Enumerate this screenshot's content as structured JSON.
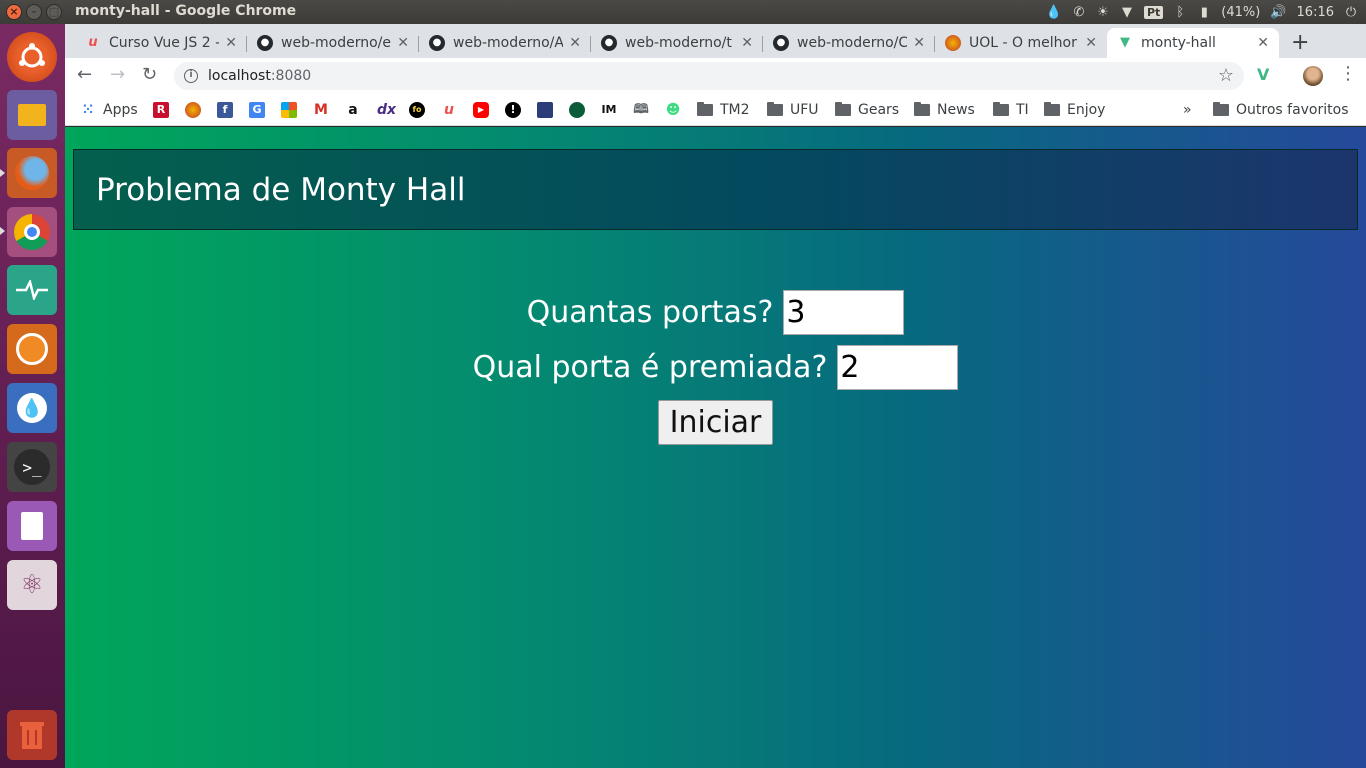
{
  "system": {
    "window_title": "monty-hall - Google Chrome",
    "battery": "(41%)",
    "clock": "16:16",
    "keyboard": "Pt"
  },
  "tabs": [
    {
      "title": "Curso Vue JS 2 -",
      "icon": "udemy-icon",
      "active": false
    },
    {
      "title": "web-moderno/e",
      "icon": "github-icon",
      "active": false
    },
    {
      "title": "web-moderno/A",
      "icon": "github-icon",
      "active": false
    },
    {
      "title": "web-moderno/t",
      "icon": "github-icon",
      "active": false
    },
    {
      "title": "web-moderno/C",
      "icon": "github-icon",
      "active": false
    },
    {
      "title": "UOL - O melhor",
      "icon": "uol-icon",
      "active": false
    },
    {
      "title": "monty-hall",
      "icon": "vue-icon",
      "active": true
    }
  ],
  "toolbar": {
    "url_host": "localhost",
    "url_port": ":8080"
  },
  "bookmarks": {
    "apps_label": "Apps",
    "folders": [
      "TM2",
      "UFU",
      "Gears",
      "News",
      "TI",
      "Enjoy"
    ],
    "overflow": "»",
    "other": "Outros favoritos"
  },
  "page": {
    "title": "Problema de Monty Hall",
    "doors_label": "Quantas portas?",
    "doors_value": "3",
    "prize_label": "Qual porta é premiada?",
    "prize_value": "2",
    "start_label": "Iniciar"
  },
  "colors": {
    "gradient_left": "#00a65a",
    "gradient_right": "#25499a",
    "launcher": "#5e1d4f"
  }
}
